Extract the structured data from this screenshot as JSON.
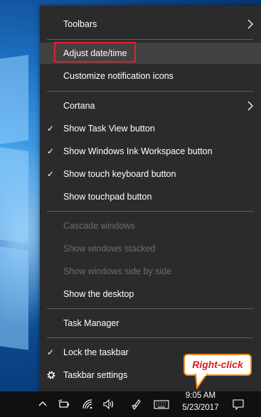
{
  "menu": {
    "items": [
      {
        "label": "Toolbars"
      },
      {
        "label": "Adjust date/time"
      },
      {
        "label": "Customize notification icons"
      },
      {
        "label": "Cortana"
      },
      {
        "label": "Show Task View button",
        "checked": true
      },
      {
        "label": "Show Windows Ink Workspace button",
        "checked": true
      },
      {
        "label": "Show touch keyboard button",
        "checked": true
      },
      {
        "label": "Show touchpad button"
      },
      {
        "label": "Cascade windows",
        "disabled": true
      },
      {
        "label": "Show windows stacked",
        "disabled": true
      },
      {
        "label": "Show windows side by side",
        "disabled": true
      },
      {
        "label": "Show the desktop"
      },
      {
        "label": "Task Manager"
      },
      {
        "label": "Lock the taskbar",
        "checked": true
      },
      {
        "label": "Taskbar settings"
      }
    ],
    "check_glyph": "✓"
  },
  "taskbar": {
    "time": "9:05 AM",
    "date": "5/23/2017",
    "icons": [
      "chevron-up-icon",
      "power-icon",
      "wifi-icon",
      "volume-icon",
      "pen-icon",
      "keyboard-icon",
      "notification-icon"
    ]
  },
  "annotation": {
    "callout_text": "Right-click"
  },
  "colors": {
    "menu_bg": "#2b2b2b",
    "hover_bg": "#414141",
    "highlight_border": "#e0202a",
    "callout_border": "#f08a1e",
    "callout_text": "#e01b1b"
  }
}
